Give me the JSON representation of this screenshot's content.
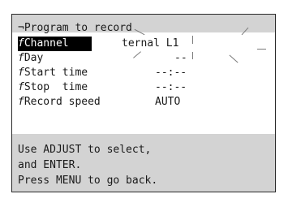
{
  "screen": {
    "title": "¬Program to record",
    "rows": [
      {
        "marker": "f",
        "label": "Channel",
        "value": "ternal L1",
        "selected": true
      },
      {
        "marker": "f",
        "label": "Day",
        "value": "--",
        "selected": false
      },
      {
        "marker": "f",
        "label": "Start time",
        "value": "--:--",
        "selected": false
      },
      {
        "marker": "f",
        "label": "Stop  time",
        "value": "--:--",
        "selected": false
      },
      {
        "marker": "f",
        "label": "Record speed",
        "value": "AUTO",
        "selected": false
      }
    ],
    "message": {
      "line1": "Use ADJUST to select,",
      "line2": "and ENTER.",
      "line3": "Press MENU to go back."
    }
  }
}
